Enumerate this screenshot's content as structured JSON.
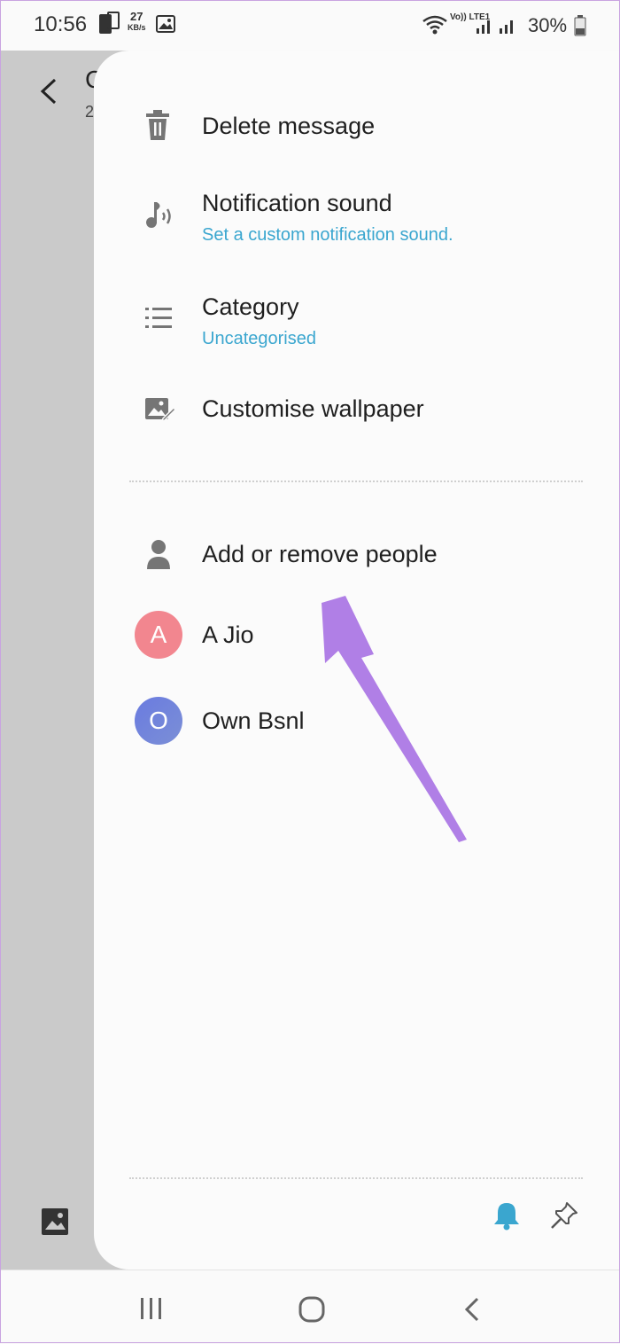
{
  "status_bar": {
    "time": "10:56",
    "net_speed": "27",
    "net_speed_unit": "KB/s",
    "network_label": "Vo)) LTE1",
    "battery": "30%"
  },
  "conversation": {
    "title": "C",
    "subtitle": "2"
  },
  "drawer": {
    "items": [
      {
        "label": "Delete message",
        "icon": "trash-icon"
      },
      {
        "label": "Notification sound",
        "sub": "Set a custom notification sound.",
        "icon": "music-note-icon"
      },
      {
        "label": "Category",
        "sub": "Uncategorised",
        "icon": "list-icon"
      },
      {
        "label": "Customise wallpaper",
        "icon": "wallpaper-edit-icon"
      }
    ],
    "people_header": {
      "label": "Add or remove people",
      "icon": "person-icon"
    },
    "participants": [
      {
        "initial": "A",
        "name": "A Jio",
        "color": "#f2868f"
      },
      {
        "initial": "O",
        "name": "Own Bsnl",
        "color": "#6f7fdc"
      }
    ]
  },
  "colors": {
    "accent_blue": "#3aa6cf",
    "arrow_purple": "#b07fe6"
  }
}
